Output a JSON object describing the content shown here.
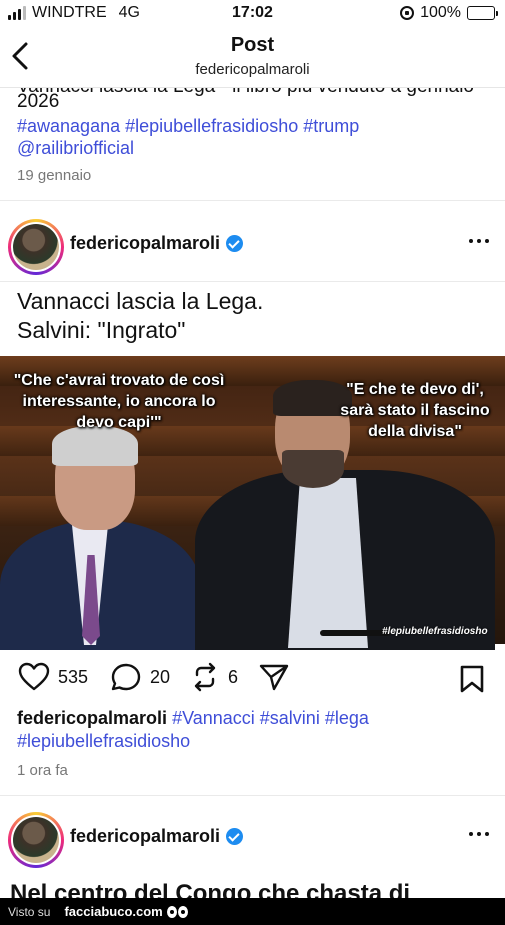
{
  "status_bar": {
    "carrier": "WINDTRE",
    "network": "4G",
    "time": "17:02",
    "battery": "100%",
    "battery_level": 1.0
  },
  "header": {
    "title": "Post",
    "subtitle": "federicopalmaroli"
  },
  "prev_post": {
    "cut_text": "Vannacci lascia la Lega - il libro più venduto a gennaio",
    "year": "2026",
    "tags": "#awanagana #lepiubellefrasidiosho #trump @railibriofficial",
    "date": "19 gennaio"
  },
  "post": {
    "username": "federicopalmaroli",
    "title_line1": "Vannacci lascia la Lega.",
    "title_line2": "Salvini: \"Ingrato\"",
    "image": {
      "quote_left": "\"Che c'avrai trovato de così interessante, io ancora lo devo capi'\"",
      "quote_right": "\"E che te devo di', sarà stato il fascino della divisa\"",
      "watermark": "#lepiubellefrasidiosho"
    },
    "likes": "535",
    "comments": "20",
    "reposts": "6",
    "caption_user": "federicopalmaroli",
    "caption_tags": "#Vannacci #salvini #lega #lepiubellefrasidiosho",
    "time_ago": "1 ora fa"
  },
  "next_post": {
    "username": "federicopalmaroli",
    "cut_text": "Nel centro del Congo che chasta di"
  },
  "footer": {
    "visto": "Visto su",
    "site": "facciabuco.com"
  },
  "colors": {
    "hashtag": "#3f4ed8",
    "verified": "#1d8cf0",
    "battery": "#f2c200"
  },
  "icons": [
    "back-icon",
    "heart-icon",
    "comment-icon",
    "repost-icon",
    "share-icon",
    "bookmark-icon",
    "more-icon",
    "verified-icon"
  ]
}
